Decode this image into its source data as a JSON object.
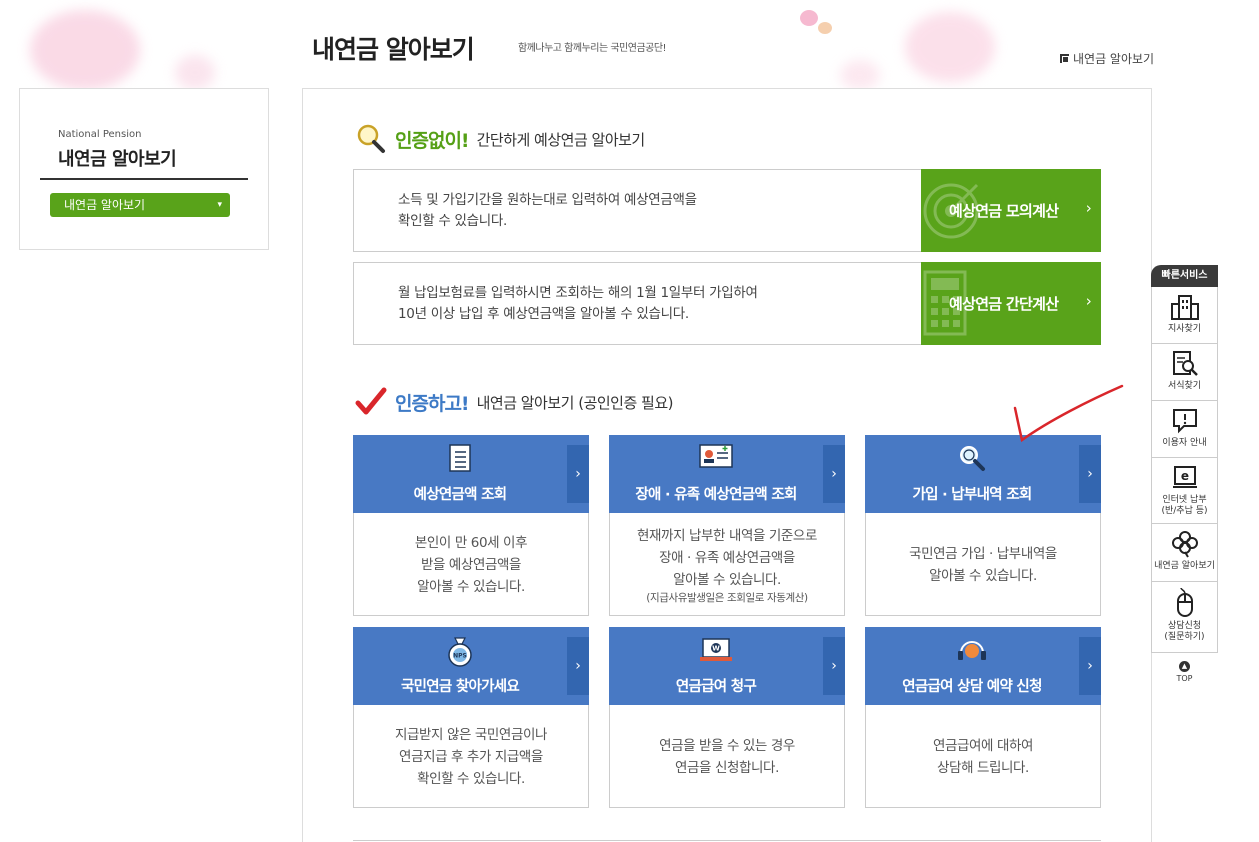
{
  "header": {
    "title": "내연금 알아보기",
    "subtitle": "함께나누고 함께누리는 국민연금공단!",
    "top_link": "내연금 알아보기"
  },
  "sidebar": {
    "en_label": "National Pension",
    "title": "내연금 알아보기",
    "select_value": "내연금 알아보기"
  },
  "section1": {
    "strong": "인증없이!",
    "rest": "간단하게 예상연금 알아보기",
    "rows": [
      {
        "line1": "소득 및 가입기간을 원하는대로 입력하여 예상연금액을",
        "line2": "확인할 수 있습니다.",
        "button": "예상연금 모의계산"
      },
      {
        "line1": "월 납입보험료를 입력하시면 조회하는 해의 1월 1일부터 가입하여",
        "line2": "10년 이상 납입 후 예상연금액을 알아볼 수 있습니다.",
        "button": "예상연금 간단계산"
      }
    ]
  },
  "section2": {
    "strong": "인증하고!",
    "rest": "내연금 알아보기 (공인인증 필요)",
    "cards": [
      {
        "title": "예상연금액 조회",
        "lines": [
          "본인이 만 60세 이후",
          "받을 예상연금액을",
          "알아볼 수 있습니다."
        ],
        "note": ""
      },
      {
        "title": "장애 · 유족 예상연금액 조회",
        "lines": [
          "현재까지 납부한 내역을 기준으로",
          "장애 · 유족 예상연금액을",
          "알아볼 수 있습니다."
        ],
        "note": "(지급사유발생일은 조회일로 자동계산)"
      },
      {
        "title": "가입 · 납부내역 조회",
        "lines": [
          "국민연금 가입 · 납부내역을",
          "알아볼 수 있습니다."
        ],
        "note": ""
      },
      {
        "title": "국민연금 찾아가세요",
        "lines": [
          "지급받지 않은 국민연금이나",
          "연금지급 후 추가 지급액을",
          "확인할 수 있습니다."
        ],
        "note": ""
      },
      {
        "title": "연금급여 청구",
        "lines": [
          "연금을 받을 수 있는 경우",
          "연금을 신청합니다."
        ],
        "note": ""
      },
      {
        "title": "연금급여 상담 예약 신청",
        "lines": [
          "연금급여에 대하여",
          "상담해 드립니다."
        ],
        "note": ""
      }
    ]
  },
  "quick_service": {
    "title": "빠른서비스",
    "items": [
      {
        "label1": "지사찾기",
        "label2": "",
        "icon": "building-icon"
      },
      {
        "label1": "서식찾기",
        "label2": "",
        "icon": "document-search-icon"
      },
      {
        "label1": "이용자 안내",
        "label2": "",
        "icon": "info-bubble-icon"
      },
      {
        "label1": "인터넷 납부",
        "label2": "(반/추납 등)",
        "icon": "e-payment-icon"
      },
      {
        "label1": "내연금 알아보기",
        "label2": "",
        "icon": "clover-icon"
      },
      {
        "label1": "상담신청",
        "label2": "(질문하기)",
        "icon": "mouse-icon"
      }
    ],
    "top_label": "TOP"
  },
  "colors": {
    "green": "#59a31a",
    "blue": "#4879c4",
    "dark_blue": "#3366b0",
    "annotation_red": "#d9262b"
  }
}
